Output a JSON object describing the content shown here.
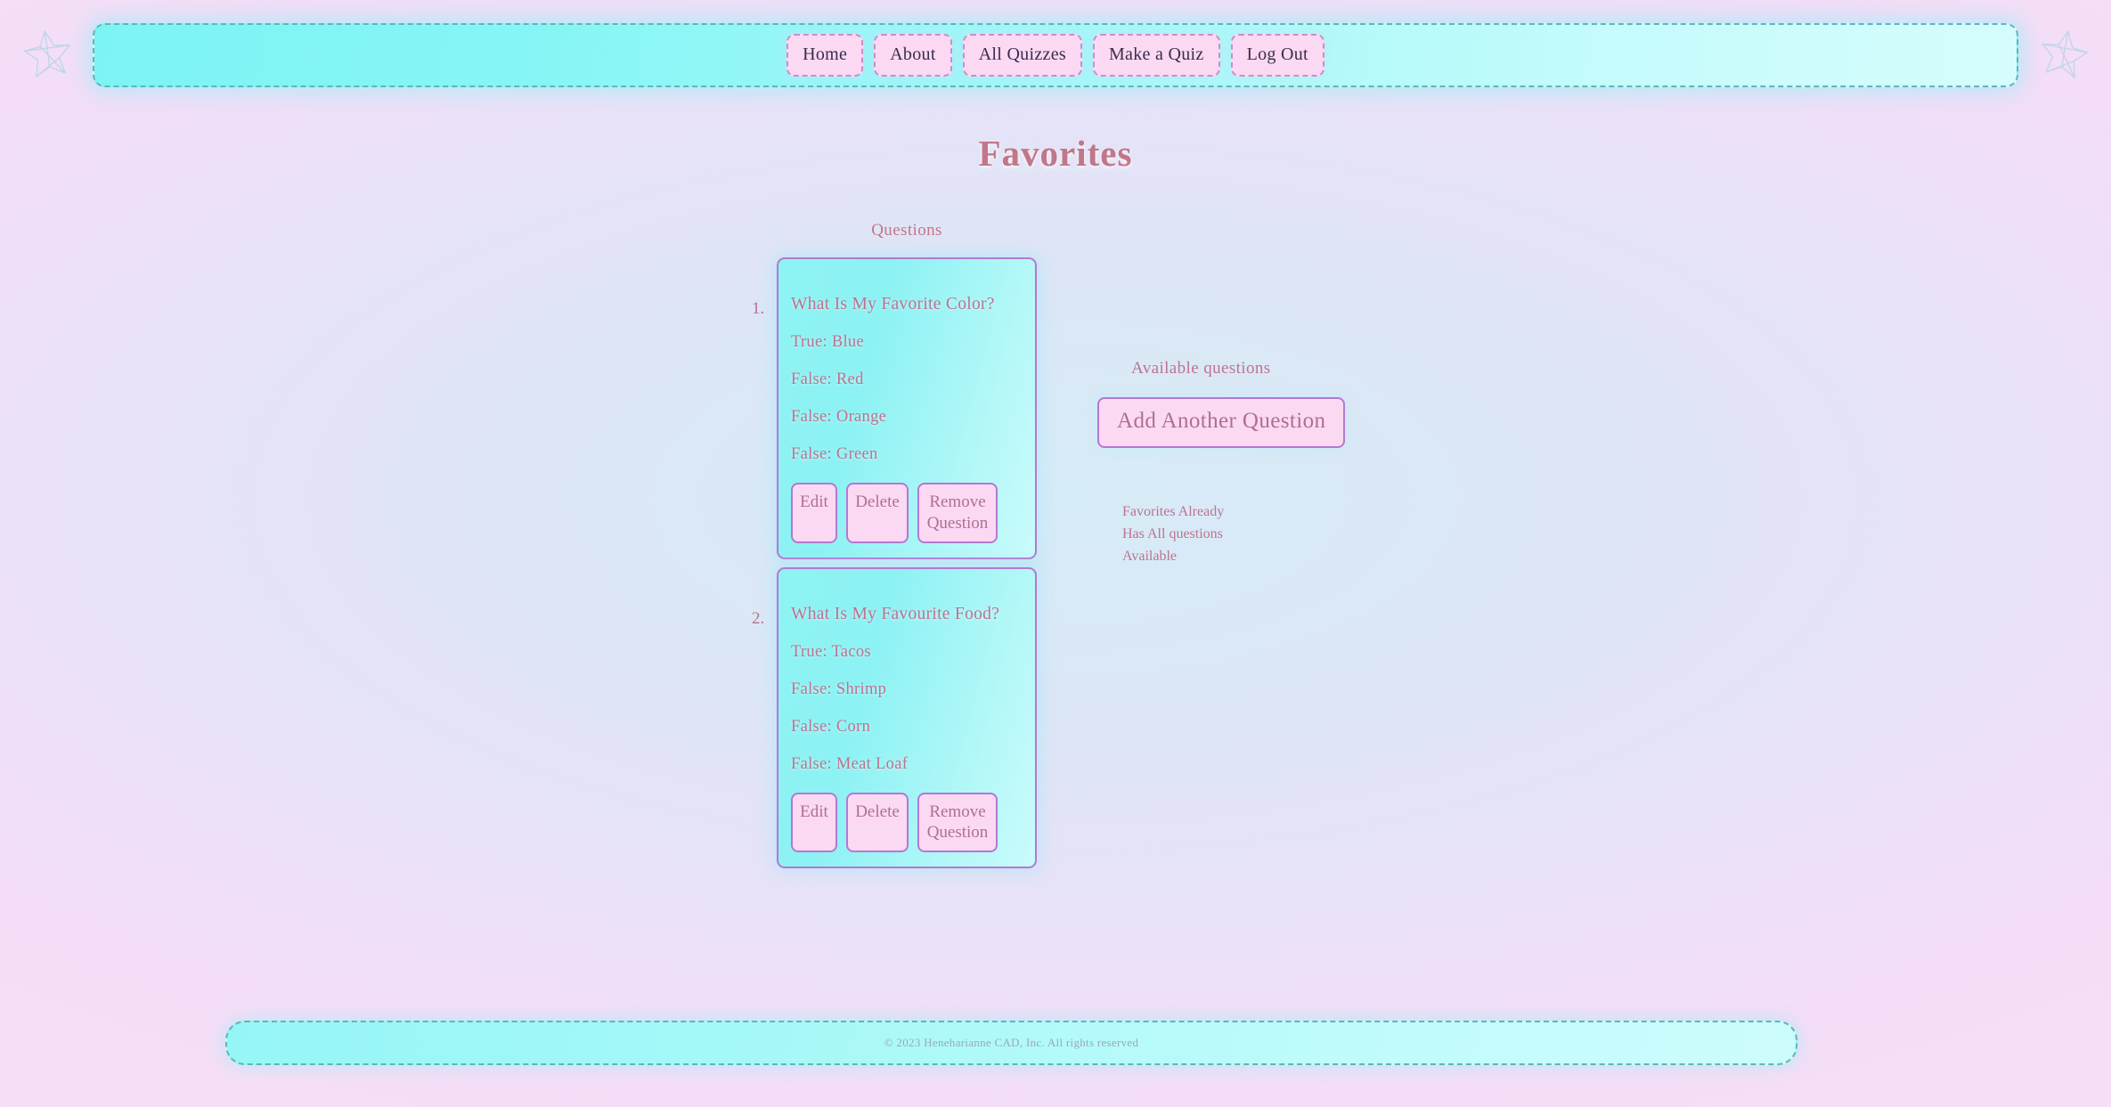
{
  "page": {
    "title": "Favorites",
    "accent_pink": "#bd7291",
    "accent_purple": "#b478d1",
    "accent_teal": "#5fb6b6",
    "card_bg": "#8ef3f3",
    "button_bg": "#fbd9f3"
  },
  "decor": {
    "left_star": "star-icon",
    "right_star": "star-icon"
  },
  "nav": {
    "items": [
      {
        "label": "Home"
      },
      {
        "label": "About"
      },
      {
        "label": "All Quizzes"
      },
      {
        "label": "Make a Quiz"
      },
      {
        "label": "Log Out"
      }
    ]
  },
  "questions_section": {
    "heading": "Questions",
    "cards": [
      {
        "number": "1.",
        "question": "What Is My Favorite Color?",
        "answers": [
          "True: Blue",
          "False: Red",
          "False: Orange",
          "False: Green"
        ],
        "actions": {
          "edit": "Edit",
          "delete": "Delete",
          "remove": "Remove Question"
        }
      },
      {
        "number": "2.",
        "question": "What Is My Favourite Food?",
        "answers": [
          "True: Tacos",
          "False: Shrimp",
          "False: Corn",
          "False: Meat Loaf"
        ],
        "actions": {
          "edit": "Edit",
          "delete": "Delete",
          "remove": "Remove Question"
        }
      }
    ]
  },
  "available_section": {
    "heading": "Available questions",
    "add_button": "Add Another Question",
    "note": "Favorites Already Has All questions Available"
  },
  "footer": {
    "text": "© 2023 Heneharianne CAD, Inc. All rights reserved"
  }
}
